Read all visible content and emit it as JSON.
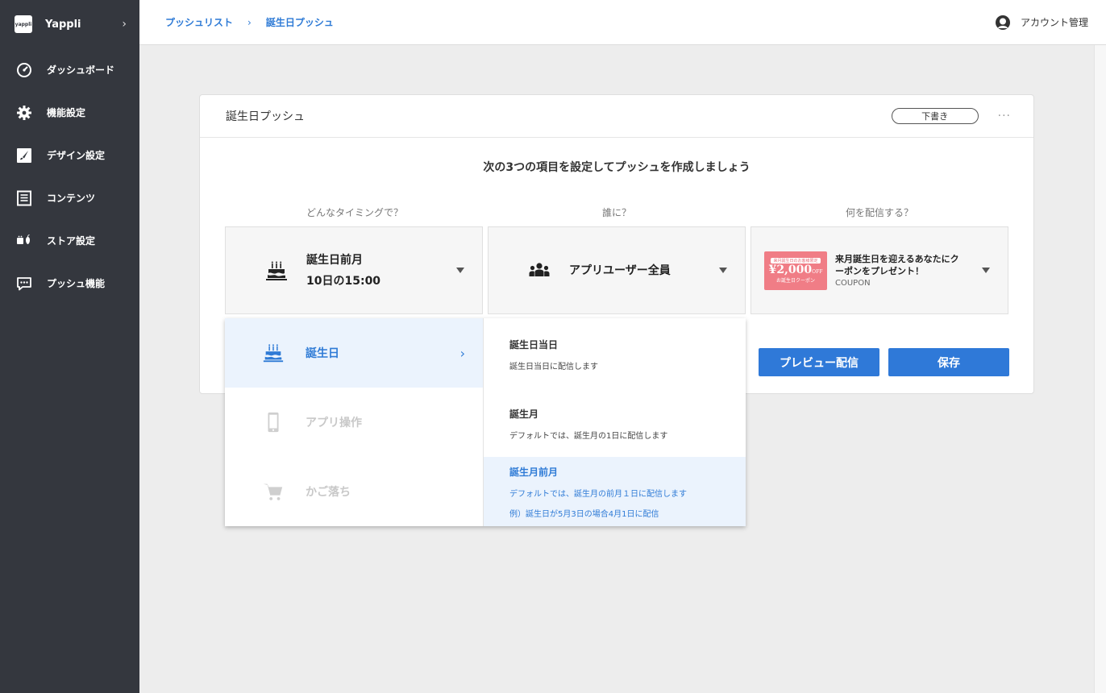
{
  "sidebar": {
    "brand": {
      "logo_text": "yappli",
      "name": "Yappli",
      "chevron": "›"
    },
    "items": [
      {
        "label": "ダッシュボード",
        "icon": "dashboard-icon"
      },
      {
        "label": "機能設定",
        "icon": "gear-icon"
      },
      {
        "label": "デザイン設定",
        "icon": "brush-icon"
      },
      {
        "label": "コンテンツ",
        "icon": "document-icon"
      },
      {
        "label": "ストア設定",
        "icon": "store-icon"
      },
      {
        "label": "プッシュ機能",
        "icon": "chat-bubble-icon"
      }
    ]
  },
  "header": {
    "breadcrumb": [
      "プッシュリスト",
      "誕生日プッシュ"
    ],
    "breadcrumb_sep": "›",
    "account_label": "アカウント管理"
  },
  "card": {
    "title": "誕生日プッシュ",
    "status": "下書き",
    "more": "···",
    "lead": "次の3つの項目を設定してプッシュを作成しましょう",
    "columns": {
      "timing": {
        "label": "どんなタイミングで？",
        "line1": "誕生日前月",
        "line2": "10日の15:00"
      },
      "target": {
        "label": "誰に？",
        "value": "アプリユーザー全員"
      },
      "content": {
        "label": "何を配信する？",
        "coupon_top": "来月誕生日のお客様限定",
        "coupon_amount": "¥2,000",
        "coupon_off": "OFF",
        "coupon_bottom": "お誕生日クーポン",
        "title": "来月誕生日を迎えるあなたにクーポンをプレゼント！",
        "tag": "COUPON"
      }
    },
    "buttons": {
      "preview": "プレビュー配信",
      "save": "保存"
    }
  },
  "dropdown": {
    "categories": [
      {
        "label": "誕生日",
        "chevron": "›",
        "state": "active"
      },
      {
        "label": "アプリ操作",
        "state": "disabled"
      },
      {
        "label": "かご落ち",
        "state": "disabled"
      }
    ],
    "options": [
      {
        "title": "誕生日当日",
        "desc": "誕生日当日に配信します"
      },
      {
        "title": "誕生月",
        "desc": "デフォルトでは、誕生月の1日に配信します"
      },
      {
        "title": "誕生月前月",
        "desc": "デフォルトでは、誕生月の前月１日に配信します",
        "desc2": "例）誕生日が5月3日の場合4月1日に配信"
      }
    ]
  },
  "colors": {
    "accent": "#2f79d8",
    "sidebar_bg": "#34373e",
    "selected_bg": "#ebf3fd"
  }
}
